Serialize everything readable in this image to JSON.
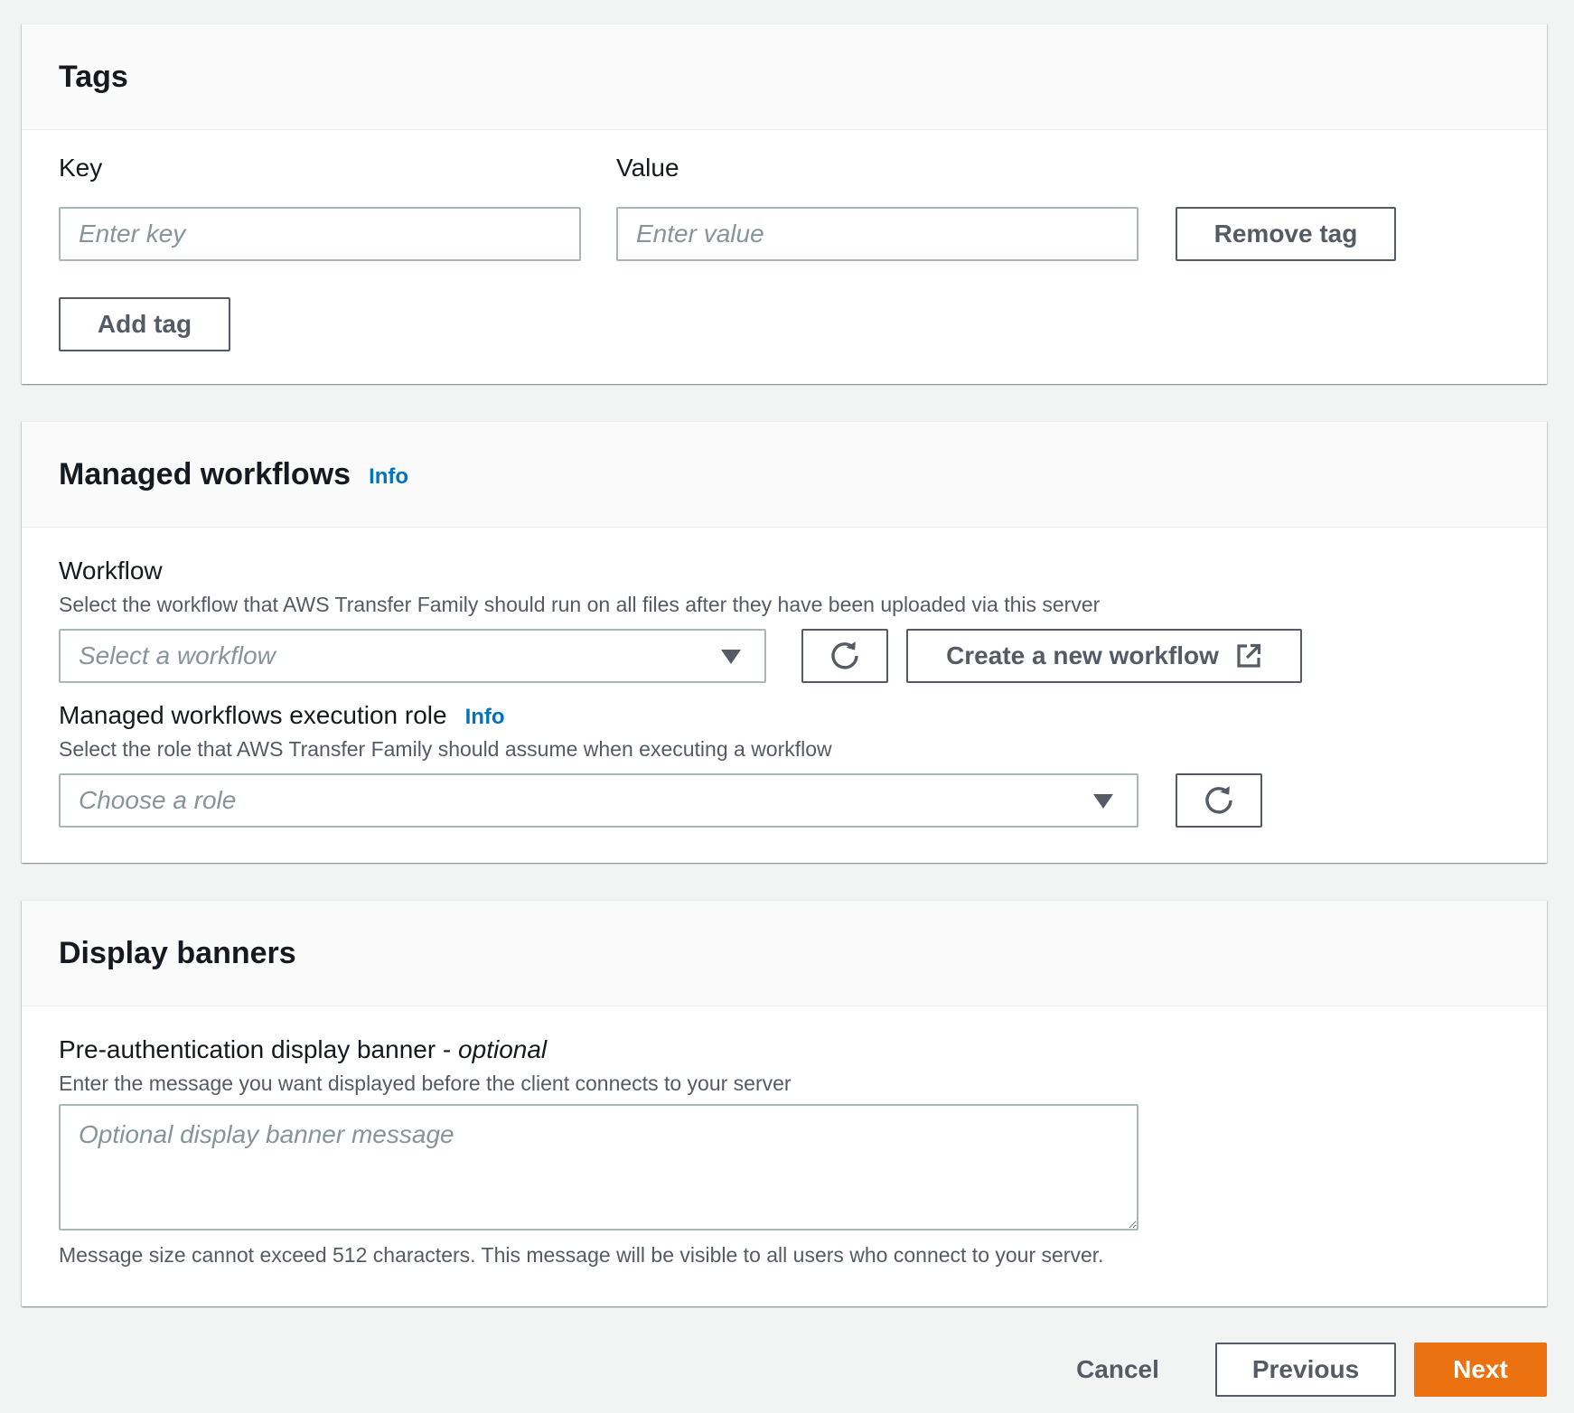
{
  "tags": {
    "title": "Tags",
    "key_label": "Key",
    "key_placeholder": "Enter key",
    "value_label": "Value",
    "value_placeholder": "Enter value",
    "remove_tag_label": "Remove tag",
    "add_tag_label": "Add tag"
  },
  "workflows": {
    "title": "Managed workflows",
    "info_label": "Info",
    "workflow_label": "Workflow",
    "workflow_description": "Select the workflow that AWS Transfer Family should run on all files after they have been uploaded via this server",
    "workflow_placeholder": "Select a workflow",
    "create_workflow_label": "Create a new workflow",
    "role_label": "Managed workflows execution role",
    "role_info_label": "Info",
    "role_description": "Select the role that AWS Transfer Family should assume when executing a workflow",
    "role_placeholder": "Choose a role"
  },
  "banners": {
    "title": "Display banners",
    "pre_auth_label": "Pre-authentication display banner - ",
    "pre_auth_optional": "optional",
    "pre_auth_description": "Enter the message you want displayed before the client connects to your server",
    "pre_auth_placeholder": "Optional display banner message",
    "constraint_text": "Message size cannot exceed 512 characters. This message will be visible to all users who connect to your server."
  },
  "footer": {
    "cancel_label": "Cancel",
    "previous_label": "Previous",
    "next_label": "Next"
  },
  "colors": {
    "primary": "#ec7211",
    "link": "#0073bb",
    "page_background": "#f2f3f3"
  },
  "icons": {
    "refresh": "refresh-icon",
    "external_link": "external-link-icon",
    "dropdown": "caret-down-icon"
  }
}
